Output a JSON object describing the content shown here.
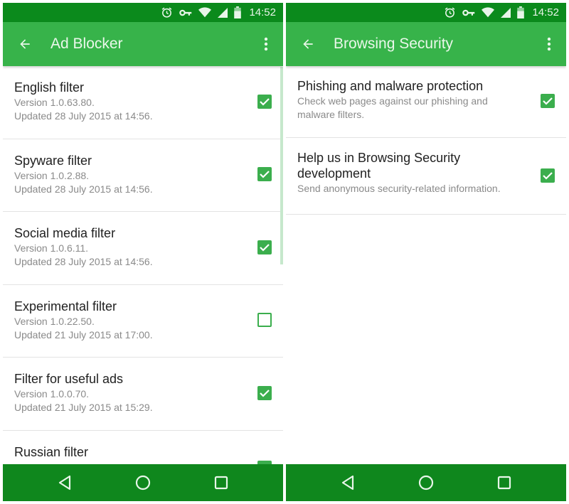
{
  "colors": {
    "status_bar": "#0b8a1c",
    "app_bar": "#37b34a",
    "nav_bar": "#0f871d",
    "checkbox": "#3bae4d"
  },
  "status_bar": {
    "icons": [
      "alarm-icon",
      "vpn-key-icon",
      "wifi-icon",
      "signal-icon",
      "battery-icon"
    ],
    "time": "14:52"
  },
  "left": {
    "app_bar": {
      "back_icon": "arrow-back-icon",
      "title": "Ad Blocker",
      "menu_icon": "more-vert-icon"
    },
    "filters": [
      {
        "title": "English filter",
        "version": "Version 1.0.63.80.",
        "updated": "Updated 28 July 2015 at 14:56.",
        "checked": true
      },
      {
        "title": "Spyware filter",
        "version": "Version 1.0.2.88.",
        "updated": "Updated 28 July 2015 at 14:56.",
        "checked": true
      },
      {
        "title": "Social media filter",
        "version": "Version 1.0.6.11.",
        "updated": "Updated 28 July 2015 at 14:56.",
        "checked": true
      },
      {
        "title": "Experimental filter",
        "version": "Version 1.0.22.50.",
        "updated": "Updated 21 July 2015 at 17:00.",
        "checked": false
      },
      {
        "title": "Filter for useful ads",
        "version": "Version 1.0.0.70.",
        "updated": "Updated 21 July 2015 at 15:29.",
        "checked": true
      },
      {
        "title": "Russian filter",
        "version": "",
        "updated": "",
        "checked": true
      }
    ]
  },
  "right": {
    "app_bar": {
      "back_icon": "arrow-back-icon",
      "title": "Browsing Security",
      "menu_icon": "more-vert-icon"
    },
    "settings": [
      {
        "title": "Phishing and malware protection",
        "summary": "Check web pages against our phishing and malware filters.",
        "checked": true
      },
      {
        "title": "Help us in Browsing Security development",
        "summary": "Send anonymous security-related information.",
        "checked": true
      }
    ]
  },
  "nav_bar": {
    "buttons": [
      "back-triangle-icon",
      "home-circle-icon",
      "recents-square-icon"
    ]
  }
}
